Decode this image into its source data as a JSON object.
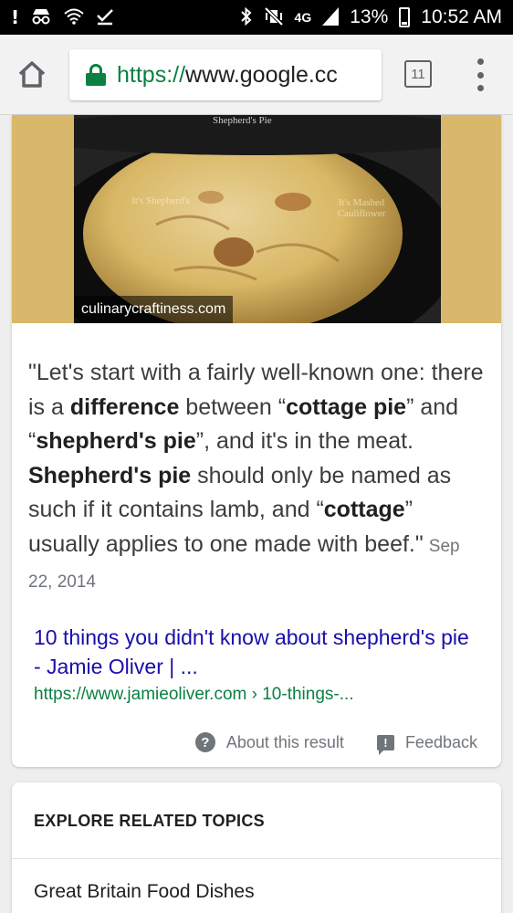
{
  "status_bar": {
    "icons_left": [
      "alert-icon",
      "incognito-icon",
      "wifi-icon",
      "download-complete-icon"
    ],
    "network": "4G",
    "battery": "13%",
    "time": "10:52 AM"
  },
  "browser": {
    "url_scheme": "https://",
    "url_host": "www.google.cc",
    "tab_count": "11"
  },
  "result": {
    "image_source": "culinarycraftiness.com",
    "image_caption_top": "Shepherd's Pie",
    "image_caption_left": "It's Shepherd's",
    "image_caption_right": "It's Mashed Cauliflower",
    "snippet_parts": [
      {
        "text": "\"Let's start with a fairly well-known one: there is a ",
        "bold": false
      },
      {
        "text": "difference",
        "bold": true
      },
      {
        "text": " between “",
        "bold": false
      },
      {
        "text": "cottage pie",
        "bold": true
      },
      {
        "text": "” and “",
        "bold": false
      },
      {
        "text": "shepherd's pie",
        "bold": true
      },
      {
        "text": "”, and it's in the meat. ",
        "bold": false
      },
      {
        "text": "Shepherd's pie",
        "bold": true
      },
      {
        "text": " should only be named as such if it contains lamb, and “",
        "bold": false
      },
      {
        "text": "cottage",
        "bold": true
      },
      {
        "text": "” usually applies to one made with beef.\"",
        "bold": false
      }
    ],
    "date": "Sep 22, 2014",
    "title": "10 things you didn't know about shepherd's pie - Jamie Oliver | ...",
    "url": "https://www.jamieoliver.com › 10-things-...",
    "about_label": "About this result",
    "feedback_label": "Feedback"
  },
  "related": {
    "heading": "EXPLORE RELATED TOPICS",
    "items": [
      "Great Britain Food Dishes"
    ]
  }
}
